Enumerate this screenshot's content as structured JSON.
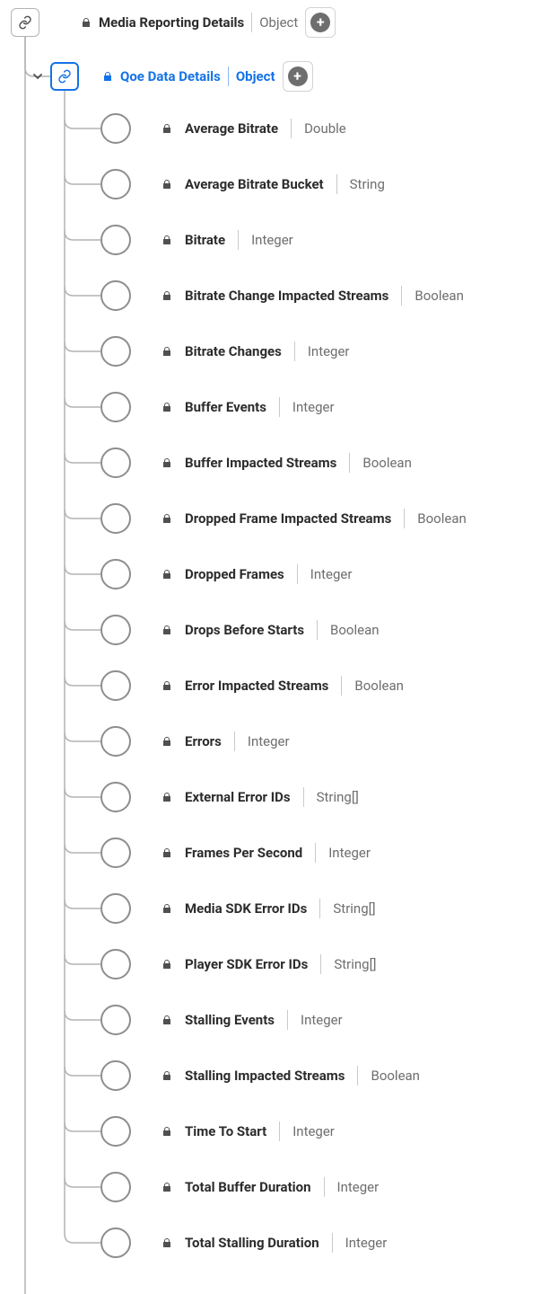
{
  "root": {
    "label": "Media Reporting Details",
    "type": "Object"
  },
  "child": {
    "label": "Qoe Data Details",
    "type": "Object"
  },
  "fields": [
    {
      "label": "Average Bitrate",
      "type": "Double"
    },
    {
      "label": "Average Bitrate Bucket",
      "type": "String"
    },
    {
      "label": "Bitrate",
      "type": "Integer"
    },
    {
      "label": "Bitrate Change Impacted Streams",
      "type": "Boolean"
    },
    {
      "label": "Bitrate Changes",
      "type": "Integer"
    },
    {
      "label": "Buffer Events",
      "type": "Integer"
    },
    {
      "label": "Buffer Impacted Streams",
      "type": "Boolean"
    },
    {
      "label": "Dropped Frame Impacted Streams",
      "type": "Boolean"
    },
    {
      "label": "Dropped Frames",
      "type": "Integer"
    },
    {
      "label": "Drops Before Starts",
      "type": "Boolean"
    },
    {
      "label": "Error Impacted Streams",
      "type": "Boolean"
    },
    {
      "label": "Errors",
      "type": "Integer"
    },
    {
      "label": "External Error IDs",
      "type": "String[]"
    },
    {
      "label": "Frames Per Second",
      "type": "Integer"
    },
    {
      "label": "Media SDK Error IDs",
      "type": "String[]"
    },
    {
      "label": "Player SDK Error IDs",
      "type": "String[]"
    },
    {
      "label": "Stalling Events",
      "type": "Integer"
    },
    {
      "label": "Stalling Impacted Streams",
      "type": "Boolean"
    },
    {
      "label": "Time To Start",
      "type": "Integer"
    },
    {
      "label": "Total Buffer Duration",
      "type": "Integer"
    },
    {
      "label": "Total Stalling Duration",
      "type": "Integer"
    }
  ]
}
